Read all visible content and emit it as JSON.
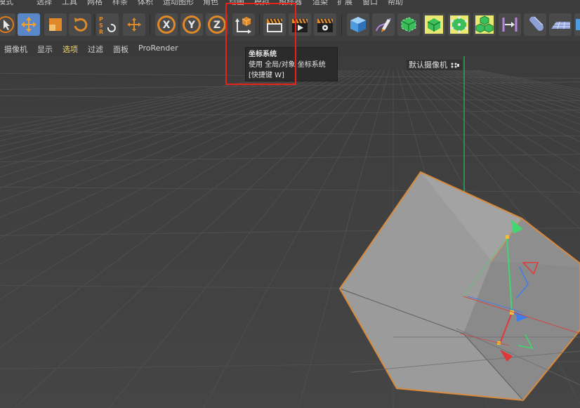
{
  "menubar": {
    "items": [
      "模式",
      "选择",
      "工具",
      "网格",
      "样条",
      "体积",
      "运动图形",
      "角色",
      "动画",
      "模拟",
      "跟踪器",
      "渲染",
      "扩展",
      "窗口",
      "帮助"
    ]
  },
  "toolbar": {
    "buttons": [
      {
        "name": "select-tool-icon"
      },
      {
        "name": "move-tool-icon",
        "active": true
      },
      {
        "name": "scale-tool-icon"
      },
      {
        "name": "rotate-tool-icon"
      },
      {
        "name": "psr-reset-icon"
      },
      {
        "name": "recent-tool-icon"
      },
      {
        "name": "x-axis-lock-icon",
        "label": "X"
      },
      {
        "name": "y-axis-lock-icon",
        "label": "Y"
      },
      {
        "name": "z-axis-lock-icon",
        "label": "Z"
      },
      {
        "name": "coordinate-system-icon"
      },
      {
        "name": "render-region-icon"
      },
      {
        "name": "render-to-picture-viewer-icon"
      },
      {
        "name": "render-settings-icon"
      },
      {
        "name": "cube-object-icon"
      },
      {
        "name": "pen-spline-icon"
      },
      {
        "name": "subdivision-surface-icon"
      },
      {
        "name": "extrude-generator-icon"
      },
      {
        "name": "cloner-icon"
      },
      {
        "name": "array-cubes-icon"
      },
      {
        "name": "deformer-icon"
      },
      {
        "name": "capsule-icon"
      },
      {
        "name": "floor-icon"
      }
    ],
    "accent_color": "#e07b1a"
  },
  "viewmenu": {
    "items": [
      "摄像机",
      "显示",
      "选项",
      "过滤",
      "面板",
      "ProRender"
    ],
    "active_index": 2
  },
  "tooltip": {
    "title": "坐标系统",
    "description": "使用 全局/对象 坐标系统",
    "shortcut": "[快捷键 W]"
  },
  "viewport": {
    "camera_label": "默认摄像机",
    "camera_icon": "camera-dots-icon",
    "grid_color": "#4a4a4a",
    "object_color": "#9a9a9a",
    "selection_color": "#d98a3d"
  },
  "colors": {
    "highlight_box": "#e8221b",
    "axis_x": "#e0383a",
    "axis_y": "#41d66e",
    "axis_z": "#3f7ee8"
  }
}
